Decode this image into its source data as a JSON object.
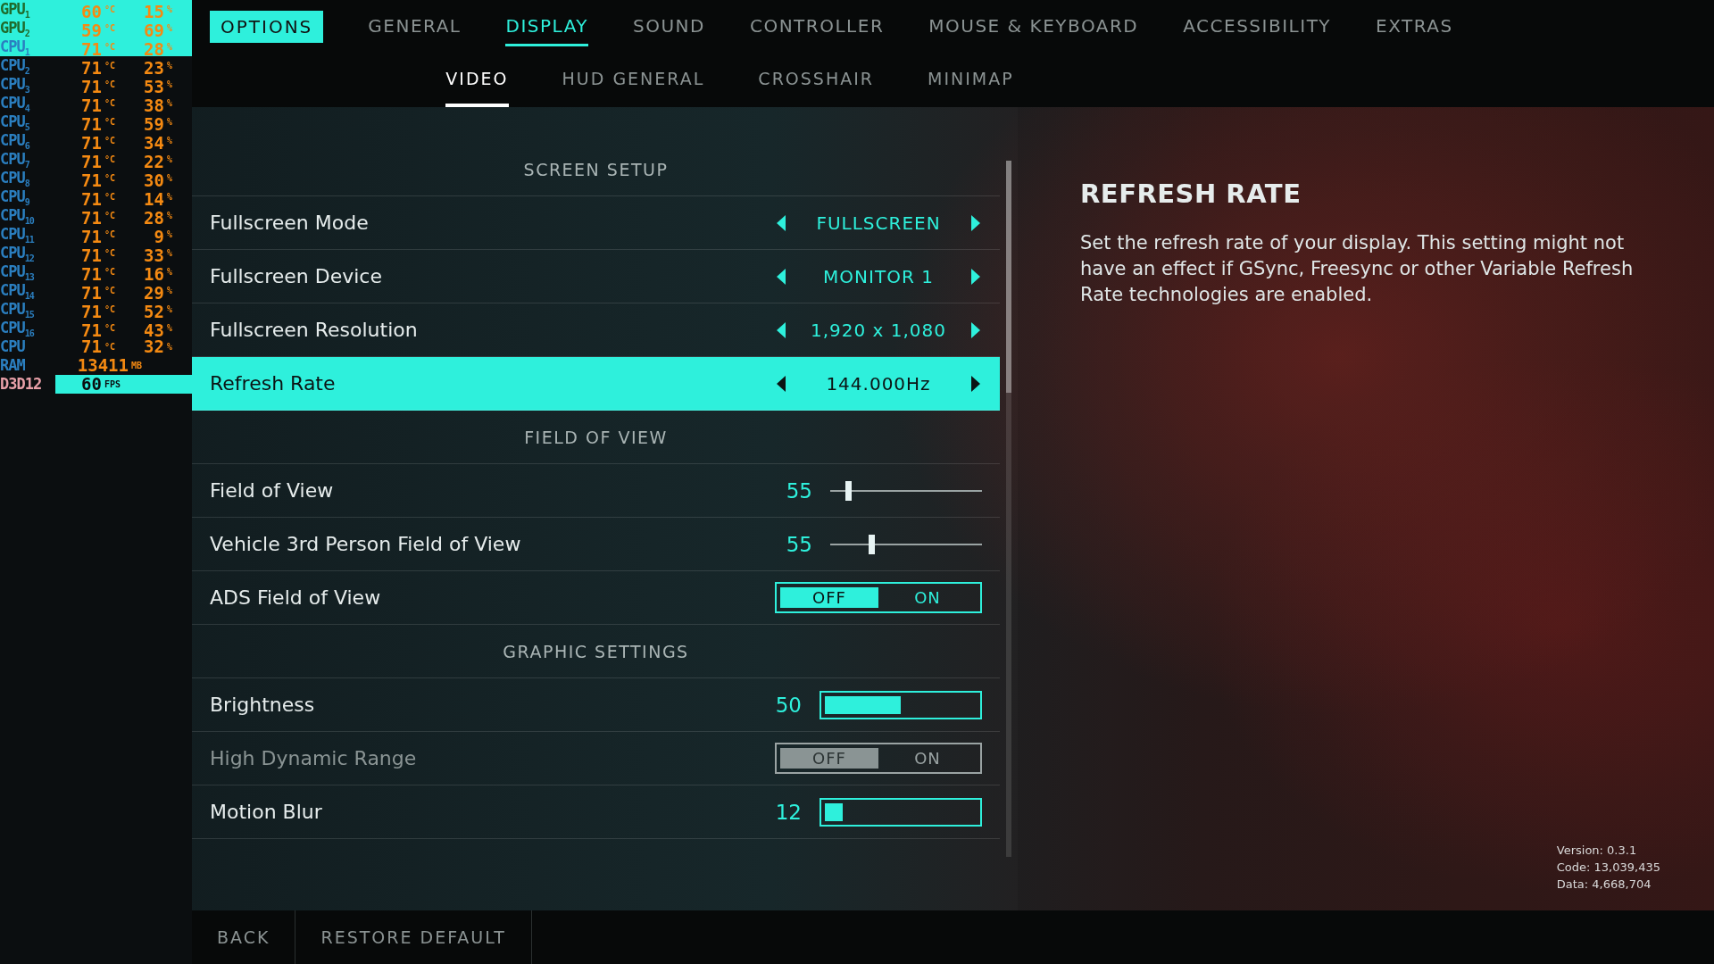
{
  "osd": {
    "rows": [
      {
        "kind": "gpu",
        "label": "GPU$_{1}$",
        "value": "60",
        "unit": "°C",
        "value2": "15",
        "unit2": "%"
      },
      {
        "kind": "gpu",
        "label": "GPU$_{2}$",
        "value": "59",
        "unit": "°C",
        "value2": "69",
        "unit2": "%"
      },
      {
        "kind": "cpu",
        "label": "CPU$_{1}$",
        "value": "71",
        "unit": "°C",
        "value2": "28",
        "unit2": "%"
      },
      {
        "kind": "cpu",
        "label": "CPU$_{2}$",
        "value": "71",
        "unit": "°C",
        "value2": "23",
        "unit2": "%"
      },
      {
        "kind": "cpu",
        "label": "CPU$_{3}$",
        "value": "71",
        "unit": "°C",
        "value2": "53",
        "unit2": "%"
      },
      {
        "kind": "cpu",
        "label": "CPU$_{4}$",
        "value": "71",
        "unit": "°C",
        "value2": "38",
        "unit2": "%"
      },
      {
        "kind": "cpu",
        "label": "CPU$_{5}$",
        "value": "71",
        "unit": "°C",
        "value2": "59",
        "unit2": "%"
      },
      {
        "kind": "cpu",
        "label": "CPU$_{6}$",
        "value": "71",
        "unit": "°C",
        "value2": "34",
        "unit2": "%"
      },
      {
        "kind": "cpu",
        "label": "CPU$_{7}$",
        "value": "71",
        "unit": "°C",
        "value2": "22",
        "unit2": "%"
      },
      {
        "kind": "cpu",
        "label": "CPU$_{8}$",
        "value": "71",
        "unit": "°C",
        "value2": "30",
        "unit2": "%"
      },
      {
        "kind": "cpu",
        "label": "CPU$_{9}$",
        "value": "71",
        "unit": "°C",
        "value2": "14",
        "unit2": "%"
      },
      {
        "kind": "cpu",
        "label": "CPU$_{10}$",
        "value": "71",
        "unit": "°C",
        "value2": "28",
        "unit2": "%"
      },
      {
        "kind": "cpu",
        "label": "CPU$_{11}$",
        "value": "71",
        "unit": "°C",
        "value2": "9",
        "unit2": "%"
      },
      {
        "kind": "cpu",
        "label": "CPU$_{12}$",
        "value": "71",
        "unit": "°C",
        "value2": "33",
        "unit2": "%"
      },
      {
        "kind": "cpu",
        "label": "CPU$_{13}$",
        "value": "71",
        "unit": "°C",
        "value2": "16",
        "unit2": "%"
      },
      {
        "kind": "cpu",
        "label": "CPU$_{14}$",
        "value": "71",
        "unit": "°C",
        "value2": "29",
        "unit2": "%"
      },
      {
        "kind": "cpu",
        "label": "CPU$_{15}$",
        "value": "71",
        "unit": "°C",
        "value2": "52",
        "unit2": "%"
      },
      {
        "kind": "cpu",
        "label": "CPU$_{16}$",
        "value": "71",
        "unit": "°C",
        "value2": "43",
        "unit2": "%"
      },
      {
        "kind": "cpu",
        "label": "CPU",
        "value": "71",
        "unit": "°C",
        "value2": "32",
        "unit2": "%"
      },
      {
        "kind": "ram",
        "label": "RAM",
        "value": "13411",
        "unit": "MB"
      },
      {
        "kind": "api",
        "label": "D3D12",
        "value": "60",
        "unit": "FPS"
      }
    ]
  },
  "header": {
    "title": "OPTIONS"
  },
  "tabs": [
    {
      "label": "GENERAL",
      "selected": false
    },
    {
      "label": "DISPLAY",
      "selected": true
    },
    {
      "label": "SOUND",
      "selected": false
    },
    {
      "label": "CONTROLLER",
      "selected": false
    },
    {
      "label": "MOUSE & KEYBOARD",
      "selected": false
    },
    {
      "label": "ACCESSIBILITY",
      "selected": false
    },
    {
      "label": "EXTRAS",
      "selected": false
    }
  ],
  "subtabs": [
    {
      "label": "VIDEO",
      "selected": true
    },
    {
      "label": "HUD GENERAL",
      "selected": false
    },
    {
      "label": "CROSSHAIR",
      "selected": false
    },
    {
      "label": "MINIMAP",
      "selected": false
    }
  ],
  "settings": [
    {
      "kind": "section",
      "label": "SCREEN SETUP"
    },
    {
      "kind": "selector",
      "label": "Fullscreen Mode",
      "value": "FULLSCREEN",
      "selected": false,
      "disabled": false
    },
    {
      "kind": "selector",
      "label": "Fullscreen Device",
      "value": "MONITOR 1",
      "selected": false,
      "disabled": false
    },
    {
      "kind": "selector",
      "label": "Fullscreen Resolution",
      "value": "1,920 x 1,080",
      "selected": false,
      "disabled": false
    },
    {
      "kind": "selector",
      "label": "Refresh Rate",
      "value": "144.000Hz",
      "selected": true,
      "disabled": false
    },
    {
      "kind": "section",
      "label": "FIELD OF VIEW"
    },
    {
      "kind": "slider",
      "label": "Field of View",
      "value": "55",
      "level": 0.12,
      "selected": false,
      "disabled": false
    },
    {
      "kind": "slider",
      "label": "Vehicle 3rd Person Field of View",
      "value": "55",
      "level": 0.27,
      "selected": false,
      "disabled": false
    },
    {
      "kind": "toggle",
      "label": "ADS Field of View",
      "options": [
        {
          "label": "OFF",
          "selected": true
        },
        {
          "label": "ON",
          "selected": false
        }
      ],
      "selected": false,
      "disabled": false
    },
    {
      "kind": "section",
      "label": "GRAPHIC SETTINGS"
    },
    {
      "kind": "bar",
      "label": "Brightness",
      "value": "50",
      "level": 0.5,
      "selected": false,
      "disabled": false
    },
    {
      "kind": "toggle",
      "label": "High Dynamic Range",
      "options": [
        {
          "label": "OFF",
          "selected": true
        },
        {
          "label": "ON",
          "selected": false
        }
      ],
      "selected": false,
      "disabled": true
    },
    {
      "kind": "bar",
      "label": "Motion Blur",
      "value": "12",
      "level": 0.12,
      "selected": false,
      "disabled": false
    }
  ],
  "description": {
    "title": "REFRESH RATE",
    "text": "Set the refresh rate of your display. This setting might not have an effect if GSync, Freesync or other Variable Refresh Rate technologies are enabled."
  },
  "version": [
    "Version: 0.3.1",
    "Code: 13,039,435",
    "Data: 4,668,704"
  ],
  "footer": {
    "buttons": [
      "BACK",
      "RESTORE DEFAULT"
    ]
  }
}
